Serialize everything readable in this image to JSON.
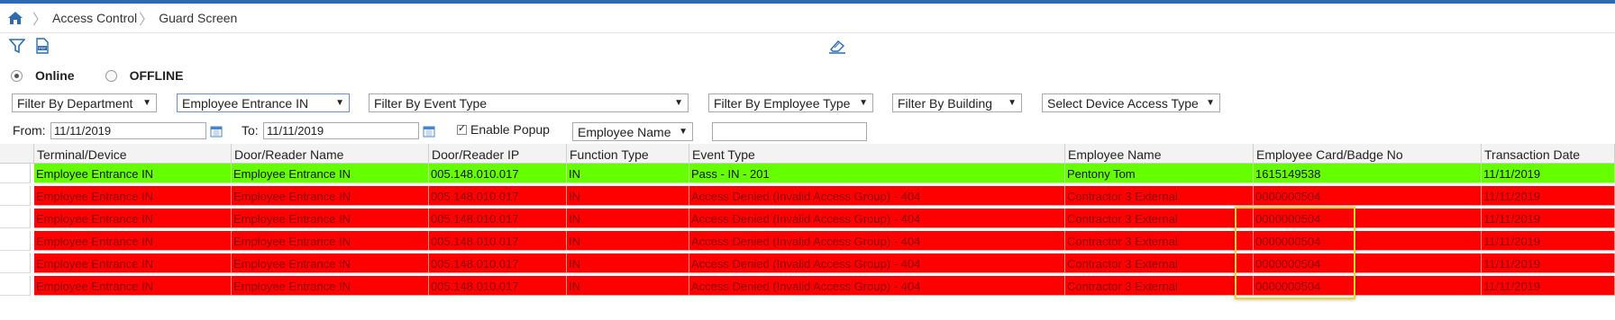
{
  "breadcrumb": {
    "items": [
      "Access Control",
      "Guard Screen"
    ]
  },
  "toolbar": {
    "filter_icon": "filter-icon",
    "pdf_icon": "pdf-export-icon",
    "clear_icon": "eraser-icon"
  },
  "mode": {
    "online_label": "Online",
    "offline_label": "OFFLINE",
    "selected": "Online"
  },
  "filters": {
    "department": "Filter By Department",
    "terminal": "Employee Entrance IN",
    "event_type": "Filter By Event Type",
    "employee_type": "Filter By Employee Type",
    "building": "Filter By Building",
    "device_access_type": "Select Device Access Type",
    "from_label": "From:",
    "from_value": "11/11/2019",
    "to_label": "To:",
    "to_value": "11/11/2019",
    "enable_popup_label": "Enable Popup",
    "enable_popup_checked": true,
    "search_field": "Employee Name",
    "search_value": ""
  },
  "table": {
    "columns": [
      "Terminal/Device",
      "Door/Reader Name",
      "Door/Reader IP",
      "Function Type",
      "Event Type",
      "Employee Name",
      "Employee Card/Badge No",
      "Transaction Date"
    ],
    "rows": [
      {
        "status": "green",
        "cells": [
          "Employee Entrance IN",
          "Employee Entrance IN",
          "005.148.010.017",
          "IN",
          "Pass - IN - 201",
          "Pentony Tom",
          "1615149538",
          "11/11/2019"
        ]
      },
      {
        "status": "red",
        "cells": [
          "Employee Entrance IN",
          "Employee Entrance IN",
          "005.148.010.017",
          "IN",
          "Access Denied (Invalid Access Group) - 404",
          "Contractor 3 External",
          "0000000504",
          "11/11/2019"
        ]
      },
      {
        "status": "red",
        "cells": [
          "Employee Entrance IN",
          "Employee Entrance IN",
          "005.148.010.017",
          "IN",
          "Access Denied (Invalid Access Group) - 404",
          "Contractor 3 External",
          "0000000504",
          "11/11/2019"
        ]
      },
      {
        "status": "red",
        "cells": [
          "Employee Entrance IN",
          "Employee Entrance IN",
          "005.148.010.017",
          "IN",
          "Access Denied (Invalid Access Group) - 404",
          "Contractor 3 External",
          "0000000504",
          "11/11/2019"
        ]
      },
      {
        "status": "red",
        "cells": [
          "Employee Entrance IN",
          "Employee Entrance IN",
          "005.148.010.017",
          "IN",
          "Access Denied (Invalid Access Group) - 404",
          "Contractor 3 External",
          "0000000504",
          "11/11/2019"
        ]
      },
      {
        "status": "red",
        "cells": [
          "Employee Entrance IN",
          "Employee Entrance IN",
          "005.148.010.017",
          "IN",
          "Access Denied (Invalid Access Group) - 404",
          "Contractor 3 External",
          "0000000504",
          "11/11/2019"
        ]
      }
    ]
  },
  "colors": {
    "accent": "#2b6cb0",
    "pass_row": "#66ff00",
    "denied_row": "#ff0000",
    "highlight": "#e8d530"
  }
}
